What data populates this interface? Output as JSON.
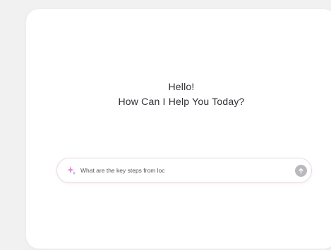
{
  "main": {
    "greeting_line1": "Hello!",
    "greeting_line2": "How Can I Help You Today?"
  },
  "prompt": {
    "value": "What are the key steps from loc",
    "leading_icon": "sparkle-icon",
    "send_icon": "arrow-up-icon"
  },
  "colors": {
    "background": "#f1f1f2",
    "card": "#ffffff",
    "sparkle_pink": "#e58ad6",
    "sparkle_purple": "#a98bef",
    "send_button": "#b9b9bd"
  }
}
